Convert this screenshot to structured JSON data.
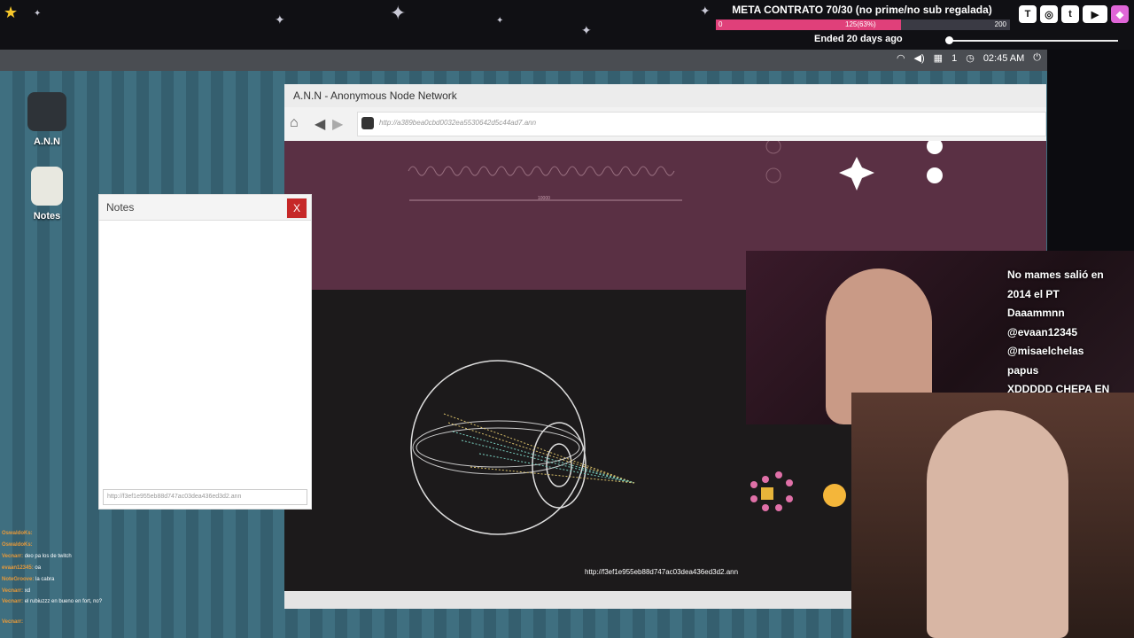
{
  "overlay": {
    "goal_title": "META CONTRATO 70/30 (no prime/no sub regalada)",
    "goal_min": "0",
    "goal_current": "125(63%)",
    "goal_max": "200",
    "goal_progress": 0.63,
    "ended_text": "Ended 20 days ago",
    "socials": [
      "twitch-icon",
      "instagram-icon",
      "twitter-icon",
      "youtube-icon",
      "gem-icon"
    ],
    "accent_color": "#e0407a"
  },
  "taskbar": {
    "notifications": "1",
    "time": "02:45 AM"
  },
  "desktop_icons": [
    {
      "label": "A.N.N"
    },
    {
      "label": "Notes"
    }
  ],
  "browser": {
    "title": "A.N.N - Anonymous Node Network",
    "address": "http://a389bea0cbd0032ea5530642d5c44ad7.ann",
    "page_url": "http://f3ef1e955eb88d747ac03dea436ed3d2.ann",
    "scale_label": "10000"
  },
  "notes": {
    "title": "Notes",
    "close_label": "X",
    "footer_url": "http://f3ef1e955eb88d747ac03dea436ed3d2.ann"
  },
  "chat_right": [
    "No mames salió en",
    "2014 el PT",
    "Daaammnn",
    "@evaan12345",
    "@misaelchelas",
    "papus",
    "XDDDDD CHEPA EN"
  ],
  "chat_left": [
    {
      "user": "OswaldoKs:",
      "msg": ""
    },
    {
      "user": "OswaldoKs:",
      "msg": ""
    },
    {
      "user": "Vecnarr:",
      "msg": "deo pa los de twitch"
    },
    {
      "user": "evaan12345:",
      "msg": "oa"
    },
    {
      "user": "NoteGroove:",
      "msg": "la cabra"
    },
    {
      "user": "Vecnarr:",
      "msg": "xd"
    },
    {
      "user": "Vecnarr:",
      "msg": "el rubiuzzz en bueno en fort, no?"
    },
    {
      "user": "Vecnarr:",
      "msg": ""
    }
  ]
}
